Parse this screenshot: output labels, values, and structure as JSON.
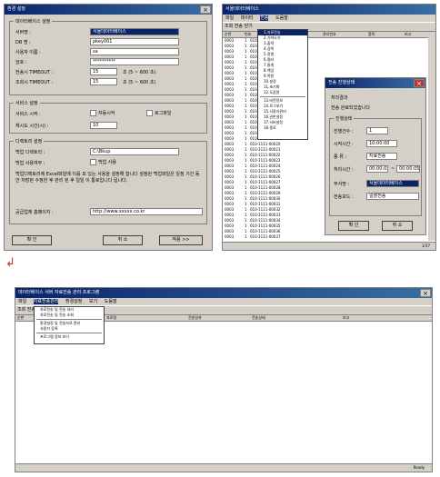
{
  "settings": {
    "title": "환경 설정",
    "db_group": "데이터베이스 설정",
    "fields": [
      {
        "label": "서버명 :",
        "value": "서울데이터베이스"
      },
      {
        "label": "DB 명 :",
        "value": "pkey001"
      },
      {
        "label": "사용자 이름 :",
        "value": "sa"
      },
      {
        "label": "암호 :",
        "value": "**********"
      },
      {
        "label": "전송시 TIMEOUT :",
        "value": "15",
        "suffix": "초 (5 ~ 600 초)"
      },
      {
        "label": "조회시 TIMEOUT :",
        "value": "15",
        "suffix": "초 (5 ~ 600 초)"
      }
    ],
    "service_group": "서비스 설정",
    "service_start_label": "서비스 시작 :",
    "auto_start": "자동시작",
    "manual_start": "로그파일",
    "retry_label": "재시도 시간(시) :",
    "retry_value": "10",
    "dir_group": "디렉토리 설정",
    "backup_dir_label": "백업 디렉토리 :",
    "backup_dir_value": "C:\\Bkup",
    "backup_use_label": "백업 사용여부 :",
    "backup_use_value": "백업 사용",
    "notice": "백업디렉토리에 Excel파일에 이를 포 있는 사용을 설정해 합니다 설정된 백업파일은 일정 기간 동안 저장된 수정한 후 관리 된 후 일일 이 통로입니다 됩니다.",
    "homepage_label": "공급업체 홈페이지 :",
    "homepage_value": "http://www.xxxxx.co.kr",
    "buttons": {
      "ok": "확 인",
      "cancel": "취 소",
      "apply": "적용 >>"
    }
  },
  "mainwin": {
    "title": "서울데이터베이스",
    "menubar": [
      "파일",
      "데이터",
      "전송",
      "도움말"
    ],
    "toolbar": "조회 전송 닫기",
    "headers": [
      "순번",
      "번호",
      "관리번호",
      "품목",
      "비고"
    ],
    "rows": [
      {
        "no": "0003",
        "a": "1",
        "b": "010-1111-00001"
      },
      {
        "no": "0003",
        "a": "1",
        "b": "010-1111-00002"
      },
      {
        "no": "0003",
        "a": "1",
        "b": "010-1111-00003"
      },
      {
        "no": "0003",
        "a": "1",
        "b": "010-1111-00004"
      },
      {
        "no": "0003",
        "a": "1",
        "b": "010-1111-00005"
      },
      {
        "no": "0003",
        "a": "1",
        "b": "010-1111-00006"
      },
      {
        "no": "0003",
        "a": "1",
        "b": "010-1111-00007"
      },
      {
        "no": "0003",
        "a": "1",
        "b": "010-1111-00008"
      },
      {
        "no": "0003",
        "a": "1",
        "b": "010-1111-00009"
      },
      {
        "no": "0003",
        "a": "1",
        "b": "010-1111-00010"
      },
      {
        "no": "0003",
        "a": "1",
        "b": "010-1111-00011"
      },
      {
        "no": "0003",
        "a": "1",
        "b": "010-1111-00012"
      },
      {
        "no": "0003",
        "a": "1",
        "b": "010-1111-00013"
      },
      {
        "no": "0003",
        "a": "1",
        "b": "010-1111-00014"
      },
      {
        "no": "0003",
        "a": "1",
        "b": "010-1111-00015"
      },
      {
        "no": "0003",
        "a": "1",
        "b": "010-1111-00016"
      },
      {
        "no": "0003",
        "a": "1",
        "b": "010-1111-00017"
      },
      {
        "no": "0003",
        "a": "1",
        "b": "010-1111-00018"
      },
      {
        "no": "0003",
        "a": "1",
        "b": "010-1111-00019"
      },
      {
        "no": "0003",
        "a": "1",
        "b": "010-1111-00020"
      },
      {
        "no": "0003",
        "a": "1",
        "b": "010-1111-00021"
      },
      {
        "no": "0003",
        "a": "1",
        "b": "010-1111-00022"
      },
      {
        "no": "0003",
        "a": "1",
        "b": "010-1111-00023"
      },
      {
        "no": "0003",
        "a": "1",
        "b": "010-1111-00024"
      },
      {
        "no": "0003",
        "a": "1",
        "b": "010-1111-00025"
      },
      {
        "no": "0003",
        "a": "1",
        "b": "010-1111-00026"
      },
      {
        "no": "0003",
        "a": "1",
        "b": "010-1111-00027"
      },
      {
        "no": "0003",
        "a": "1",
        "b": "010-1111-00028"
      },
      {
        "no": "0003",
        "a": "1",
        "b": "010-1111-00029"
      },
      {
        "no": "0003",
        "a": "1",
        "b": "010-1111-00030"
      },
      {
        "no": "0003",
        "a": "1",
        "b": "010-1111-00031"
      },
      {
        "no": "0003",
        "a": "1",
        "b": "010-1111-00032"
      },
      {
        "no": "0003",
        "a": "1",
        "b": "010-1111-00033"
      },
      {
        "no": "0003",
        "a": "1",
        "b": "010-1111-00034"
      },
      {
        "no": "0003",
        "a": "1",
        "b": "010-1111-00035"
      },
      {
        "no": "0003",
        "a": "1",
        "b": "010-1111-00036"
      },
      {
        "no": "0003",
        "a": "1",
        "b": "010-1111-00037"
      }
    ],
    "dropdown": [
      "1.자료전송",
      "2.가져오기",
      "3.출력",
      "4.검색",
      "5.정렬",
      "6.필터",
      "7.통계",
      "8.백업",
      "9.복원",
      "10.설정",
      "11.초기화",
      "12.도움말",
      "13.버전정보",
      "14.로그보기",
      "15.사용자관리",
      "16.권한설정",
      "17.서버설정",
      "18.종료"
    ],
    "status": "1/37"
  },
  "dialog": {
    "title": "전송 진행상태",
    "status_label": "처리결과",
    "status_value": "전송 완료되었습니다",
    "section": "진행상태",
    "rows": [
      {
        "label": "진행건수 :",
        "value": "1"
      },
      {
        "label": "시작시간 :",
        "value": "10:00:00"
      },
      {
        "label": "종  류 :",
        "value": "자료전송"
      },
      {
        "label": "처리시간 :",
        "value": "00:00:01"
      }
    ],
    "range_sep": "~",
    "range_end": "00:00:05",
    "dept_label": "부서명 :",
    "dept_value": "서울데이터베이스",
    "type_label": "전송모드 :",
    "type_value": "일괄전송",
    "ok": "확 인",
    "cancel": "취 소"
  },
  "arrow_glyph": "↲",
  "bottom": {
    "title": "데이터베이스 서버 자료전송 관리 프로그램",
    "menubar": [
      "파일",
      "자료전송관리",
      "환경설정",
      "보기",
      "도움말"
    ],
    "toolbar": "조회 전송 설정 인쇄 닫기",
    "headers": [
      "순번",
      "자료명",
      "전송일자",
      "전송상태",
      "비고"
    ],
    "menu": [
      "자료전송 및 전송 처리",
      "자료전송 및 전송 조회",
      "환경설정 및 전송자료 관리",
      "사용자 등록",
      "프로그램 정보 보기"
    ],
    "status": "Ready"
  }
}
